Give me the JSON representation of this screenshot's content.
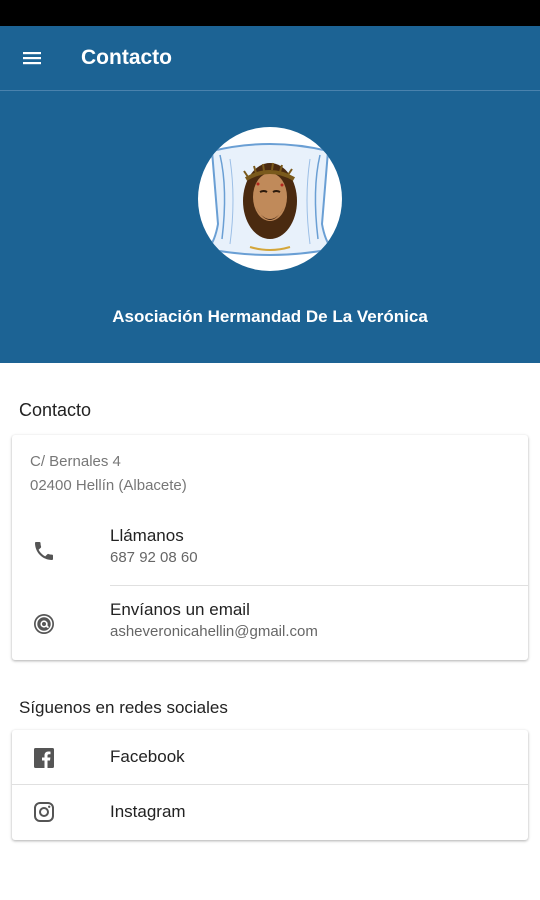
{
  "app_bar": {
    "title": "Contacto",
    "menu_icon": "menu-icon"
  },
  "header": {
    "org_name": "Asociación Hermandad De La Verónica",
    "logo": "veronica-logo"
  },
  "contact": {
    "section_title": "Contacto",
    "address_line1": "C/ Bernales 4",
    "address_line2": "02400 Hellín (Albacete)",
    "phone": {
      "label": "Llámanos",
      "value": "687 92 08 60",
      "icon": "phone-icon"
    },
    "email": {
      "label": "Envíanos un email",
      "value": "asheveronicahellin@gmail.com",
      "icon": "at-sign-icon"
    }
  },
  "social": {
    "section_title": "Síguenos en redes sociales",
    "items": [
      {
        "label": "Facebook",
        "icon": "facebook-icon"
      },
      {
        "label": "Instagram",
        "icon": "instagram-icon"
      }
    ]
  },
  "colors": {
    "primary": "#1c6394",
    "icon_gray": "#555555"
  }
}
